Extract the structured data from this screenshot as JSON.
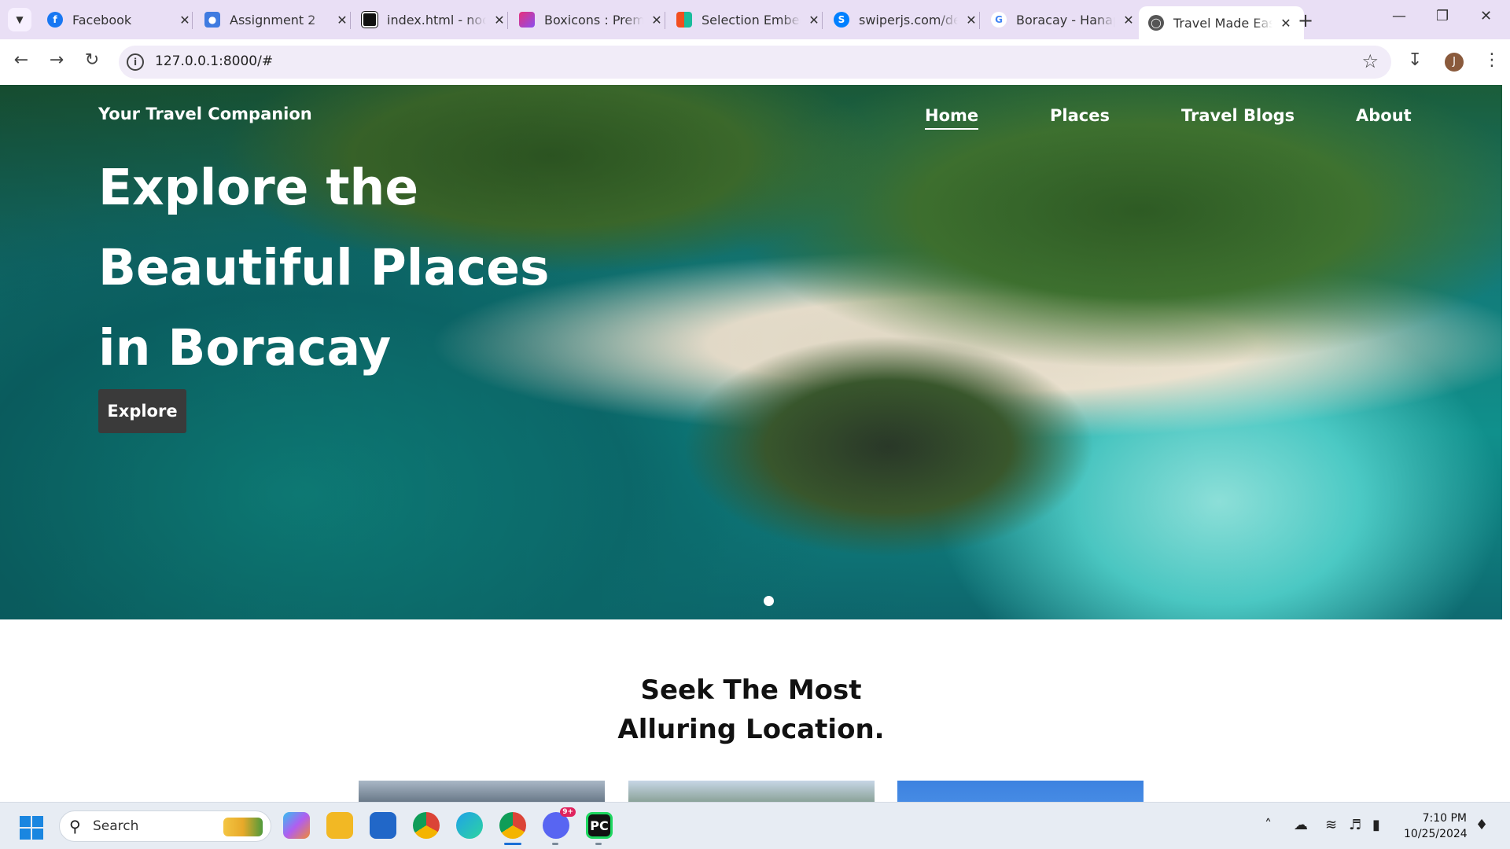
{
  "browser": {
    "tabs": [
      {
        "title": "Facebook",
        "icon": "facebook-icon",
        "color": "#1877f2"
      },
      {
        "title": "Assignment 2",
        "icon": "classroom-icon",
        "color": "#3f7be0"
      },
      {
        "title": "index.html - nod",
        "icon": "codesandbox-icon",
        "color": "#111111"
      },
      {
        "title": "Boxicons : Premi",
        "icon": "boxicons-icon",
        "color": "#e8307a"
      },
      {
        "title": "Selection Embed",
        "icon": "figma-icon",
        "color": "#f24e1e"
      },
      {
        "title": "swiperjs.com/de",
        "icon": "swiper-icon",
        "color": "#0080ff"
      },
      {
        "title": "Boracay - Hanap",
        "icon": "google-icon",
        "color": "#4285f4"
      },
      {
        "title": "Travel Made Eas",
        "icon": "globe-icon",
        "color": "#555555"
      }
    ],
    "url": "127.0.0.1:8000/#",
    "profile_initial": "J"
  },
  "site": {
    "brand": "Your Travel Companion",
    "nav": [
      "Home",
      "Places",
      "Travel Blogs",
      "About"
    ],
    "active_nav": "Home",
    "hero": {
      "title_lines": [
        "Explore the",
        "Beautiful Places",
        "in Boracay"
      ],
      "button": "Explore"
    },
    "section_title_lines": [
      "Seek The Most",
      "Alluring Location."
    ]
  },
  "taskbar": {
    "search_label": "Search",
    "time": "7:10 PM",
    "date": "10/25/2024",
    "discord_badge": "9+"
  }
}
